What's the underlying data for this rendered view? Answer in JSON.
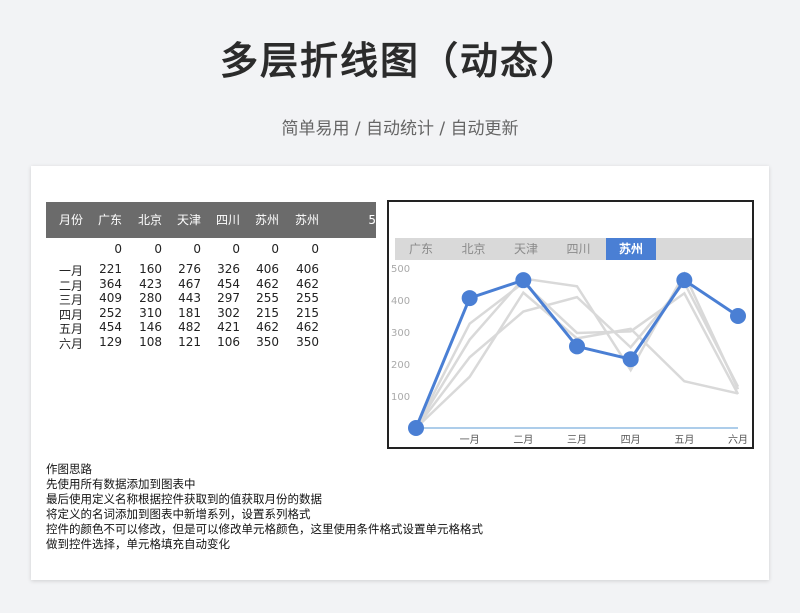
{
  "page": {
    "title": "多层折线图（动态）",
    "subtitle": "简单易用 / 自动统计 / 自动更新"
  },
  "table": {
    "headers": [
      "月份",
      "广东",
      "北京",
      "天津",
      "四川",
      "苏州",
      "苏州"
    ],
    "extra_header": "5",
    "rows": [
      [
        "",
        "0",
        "0",
        "0",
        "0",
        "0",
        "0"
      ],
      [
        "一月",
        "221",
        "160",
        "276",
        "326",
        "406",
        "406"
      ],
      [
        "二月",
        "364",
        "423",
        "467",
        "454",
        "462",
        "462"
      ],
      [
        "三月",
        "409",
        "280",
        "443",
        "297",
        "255",
        "255"
      ],
      [
        "四月",
        "252",
        "310",
        "181",
        "302",
        "215",
        "215"
      ],
      [
        "五月",
        "454",
        "146",
        "482",
        "421",
        "462",
        "462"
      ],
      [
        "六月",
        "129",
        "108",
        "121",
        "106",
        "350",
        "350"
      ]
    ]
  },
  "tabs": {
    "items": [
      "广东",
      "北京",
      "天津",
      "四川",
      "苏州"
    ],
    "selected": "苏州"
  },
  "chart_data": {
    "type": "line",
    "categories": [
      "",
      "一月",
      "二月",
      "三月",
      "四月",
      "五月",
      "六月"
    ],
    "y_ticks": [
      "100",
      "200",
      "300",
      "400",
      "500"
    ],
    "ylim": [
      0,
      500
    ],
    "grid": false,
    "series": [
      {
        "name": "广东",
        "values": [
          0,
          221,
          364,
          409,
          252,
          454,
          129
        ]
      },
      {
        "name": "北京",
        "values": [
          0,
          160,
          423,
          280,
          310,
          146,
          108
        ]
      },
      {
        "name": "天津",
        "values": [
          0,
          276,
          467,
          443,
          181,
          482,
          121
        ]
      },
      {
        "name": "四川",
        "values": [
          0,
          326,
          454,
          297,
          302,
          421,
          106
        ]
      },
      {
        "name": "苏州",
        "values": [
          0,
          406,
          462,
          255,
          215,
          462,
          350
        ]
      }
    ],
    "highlight": "苏州",
    "colors": {
      "highlight": "#4a7fd4",
      "others": "#d9d9d9",
      "axis": "#5b9bd5"
    }
  },
  "notes": [
    "作图思路",
    "先使用所有数据添加到图表中",
    "最后使用定义名称根据控件获取到的值获取月份的数据",
    "将定义的名词添加到图表中新增系列，设置系列格式",
    "控件的颜色不可以修改，但是可以修改单元格颜色，这里使用条件格式设置单元格格式",
    "做到控件选择，单元格填充自动变化"
  ]
}
